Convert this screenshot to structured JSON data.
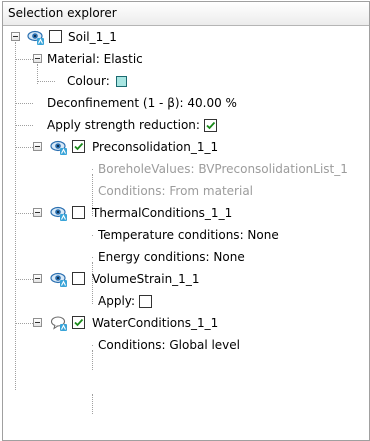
{
  "panel": {
    "title": "Selection explorer"
  },
  "tree": {
    "root": {
      "label": "Soil_1_1",
      "checked": false
    },
    "material": {
      "label": "Material: Elastic",
      "colour_label": "Colour:",
      "colour": "#a8e6e2"
    },
    "deconfinement": "Deconfinement (1 - β): 40.00 %",
    "strength_reduction": {
      "label": "Apply strength reduction:",
      "checked": true
    },
    "preconsolidation": {
      "label": "Preconsolidation_1_1",
      "checked": true,
      "borehole_values": "BoreholeValues: BVPreconsolidationList_1",
      "conditions": "Conditions: From material"
    },
    "thermal": {
      "label": "ThermalConditions_1_1",
      "checked": false,
      "temperature": "Temperature conditions: None",
      "energy": "Energy conditions: None"
    },
    "volume_strain": {
      "label": "VolumeStrain_1_1",
      "checked": false,
      "apply_label": "Apply:",
      "apply_checked": false
    },
    "water": {
      "label": "WaterConditions_1_1",
      "checked": true,
      "conditions": "Conditions: Global level"
    }
  },
  "colors": {
    "eye_icon": "#2a6fb0",
    "badge": "#3aa4d8",
    "checkmark": "#1a8a1a",
    "dim_text": "#9c9c9c",
    "tree_lines": "#a0a0a0"
  },
  "icons": {
    "visibility": "eye-icon",
    "water_visibility": "speech-bubble-icon",
    "expander": "minus-expander-icon"
  }
}
